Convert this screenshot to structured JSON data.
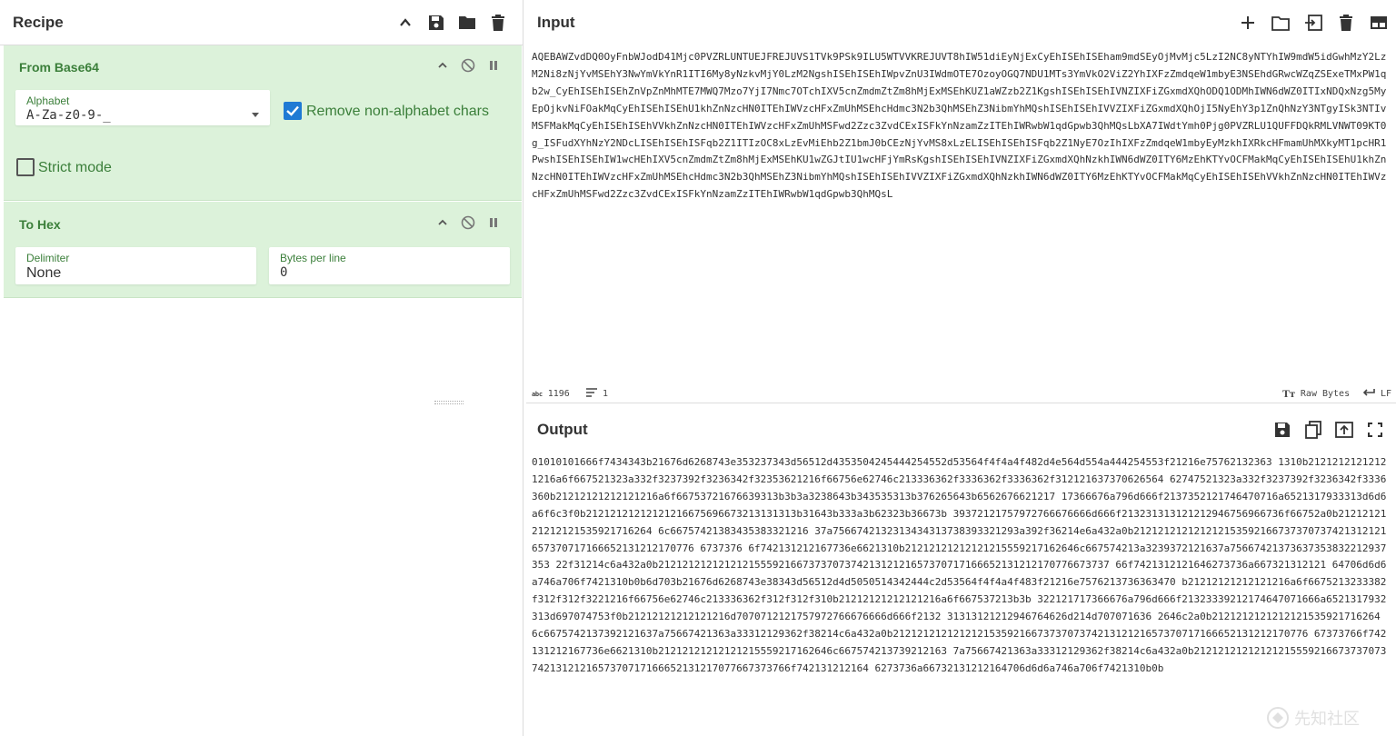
{
  "recipe": {
    "title": "Recipe",
    "operations": [
      {
        "name": "From Base64",
        "alphabet_label": "Alphabet",
        "alphabet_value": "A-Za-z0-9-_",
        "remove_nonalpha_label": "Remove non-alphabet chars",
        "remove_nonalpha_checked": true,
        "strict_mode_label": "Strict mode",
        "strict_mode_checked": false
      },
      {
        "name": "To Hex",
        "delimiter_label": "Delimiter",
        "delimiter_value": "None",
        "bytes_per_line_label": "Bytes per line",
        "bytes_per_line_value": "0"
      }
    ]
  },
  "input": {
    "title": "Input",
    "text": "AQEBAWZvdDQ0OyFnbWJodD41Mjc0PVZRLUNTUEJFREJUVS1TVk9PSk9ILU5WTVVKREJUVT8hIW51diEyNjExCyEhISEhISEham9mdSEyOjMvMjc5LzI2NC8yNTYhIW9mdW5idGwhMzY2LzM2Ni8zNjYvMSEhY3NwYmVkYnR1ITI6My8yNzkvMjY0LzM2NgshISEhISEhIWpvZnU3IWdmOTE7OzoyOGQ7NDU1MTs3YmVkO2ViZ2YhIXFzZmdqeW1mbyE3NSEhdGRwcWZqZSExeTMxPW1qb2w_CyEhISEhISEhZnVpZnMhMTE7MWQ7Mzo7YjI7Nmc7OTchIXV5cnZmdmZtZm8hMjExMSEhKUZ1aWZzb2Z1KgshISEhISEhIVNZIXFiZGxmdXQhODQ1ODMhIWN6dWZ0ITIxNDQxNzg5MyEpOjkvNiFOakMqCyEhISEhISEhU1khZnNzcHN0ITEhIWVzcHFxZmUhMSEhcHdmc3N2b3QhMSEhZ3NibmYhMQshISEhISEhIVVZIXFiZGxmdXQhOjI5NyEhY3p1ZnQhNzY3NTgyISk3NTIvMSFMakMqCyEhISEhISEhVVkhZnNzcHN0ITEhIWVzcHFxZmUhMSFwd2Zzc3ZvdCExISFkYnNzamZzITEhIWRwbW1qdGpwb3QhMQsLbXA7IWdtYmh0Pjg0PVZRLU1QUFFDQkRMLVNWT09KT0g_ISFudXYhNzY2NDcLISEhISEhISFqb2Z1ITIzOC8xLzEvMiEhb2Z1bmJ0bCEzNjYvMS8xLzELISEhISEhISFqb2Z1NyE7OzIhIXFzZmdqeW1mbyEyMzkhIXRkcHFmamUhMXkyMT1pcHR1PwshISEhISEhIW1wcHEhIXV5cnZmdmZtZm8hMjExMSEhKU1wZGJtIU1wcHFjYmRsKgshISEhISEhIVNZIXFiZGxmdXQhNzkhIWN6dWZ0ITY6MzEhKTYvOCFMakMqCyEhISEhISEhU1khZnNzcHN0ITEhIWVzcHFxZmUhMSEhcHdmc3N2b3QhMSEhZ3NibmYhMQshISEhISEhIVVZIXFiZGxmdXQhNzkhIWN6dWZ0ITY6MzEhKTYvOCFMakMqCyEhISEhISEhVVkhZnNzcHN0ITEhIWVzcHFxZmUhMSFwd2Zzc3ZvdCExISFkYnNzamZzITEhIWRwbW1qdGpwb3QhMQsL",
    "char_count": "1196",
    "line_count": "1",
    "encoding": "Raw Bytes",
    "line_ending": "LF"
  },
  "output": {
    "title": "Output",
    "text": "01010101666f7434343b21676d6268743e353237343d56512d4353504245444254552d53564f4f4a4f482d4e564d554a444254553f21216e75762132363 1310b21212121212121216a6f667521323a332f3237392f3236342f32353621216f66756e62746c213336362f3336362f3336362f312121637370626564 62747521323a332f3237392f3236342f3336360b21212121212121216a6f66753721676639313b3b3a3238643b343535313b376265643b6562676621217 17366676a796d666f2137352121746470716a6521317933313d6d6a6f6c3f0b21212121212121216675696673213131313b31643b333a3b62323b36673b 39372121757972766676666d666f213231313121212946756966736f66752a0b2121212121212121535921716264 6c66757421383435383321216 37a7566742132313434313738393321293a392f36214e6a432a0b212121212121212153592166737370737421312121657370717166652131212170776 6737376 6f742131212167736e6621310b21212121212121215559217162646c667574213a3239372121637a75667421373637353832212937353 22f31214c6a432a0b212121212121212155592166737370737421312121657370717166652131212170776673737 66f7421312121646273736a667321312121 64706d6d6a746a706f7421310b0b6d703b21676d6268743e38343d56512d4d5050514342444c2d53564f4f4a4f483f21216e7576213736363470 b21212121212121216a6f6675213233382f312f312f3221216f66756e62746c213336362f312f312f310b21212121212121216a6f667537213b3b 322121717366676a796d666f21323339212174647071666a6521317932313d697074753f0b21212121212121216d7070712121757972766676666d666f2132 31313121212946764626d214d707071636 2646c2a0b2121212121212121535921716264 6c6675742137392121637a75667421363a33312129362f38214c6a432a0b212121212121212153592166737370737421312121657370717166652131212170776 67373766f742131212167736e6621310b21212121212121215559217162646c667574213739212163 7a75667421363a33312129362f38214c6a432a0b212121212121212155592166737370737421312121657370717166652131217077667373766f742131212164 6273736a66732131212164706d6d6a746a706f7421310b0b"
  },
  "watermark": "先知社区",
  "colors": {
    "op_bg": "#dcf2da",
    "op_text": "#3b7f3a",
    "checkbox_blue": "#1f7ad4"
  }
}
